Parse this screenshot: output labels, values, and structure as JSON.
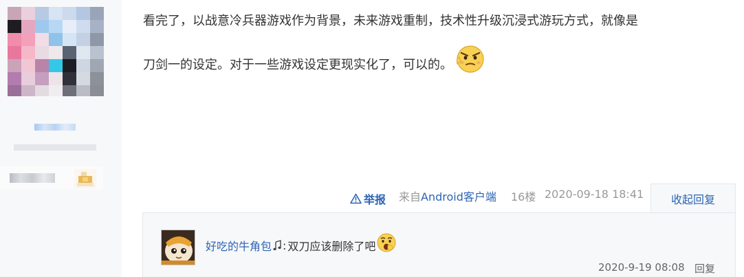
{
  "post": {
    "line1": "看完了，以战意冷兵器游戏作为背景，未来游戏重制，技术性升级沉浸式游玩方式，就像是",
    "line2": "刀剑一的设定。对于一些游戏设定更现实化了，可以的。",
    "emoji": "cool-face-emoji"
  },
  "tail": {
    "report_label": "举报",
    "client_prefix": "来自",
    "client_name": "Android客户端",
    "floor": "16楼",
    "time": "2020-09-18 18:41",
    "toggle_reply": "收起回复"
  },
  "sub_reply": {
    "user": "好吃的牛角包",
    "colon": ":",
    "text": "双刀应该删除了吧",
    "emoji": "gasp-face-emoji",
    "time": "2020-9-19 08:08",
    "reply_label": "回复"
  },
  "colors": {
    "link": "#2d64b3",
    "meta": "#999999",
    "panel": "#f7f8fa"
  }
}
